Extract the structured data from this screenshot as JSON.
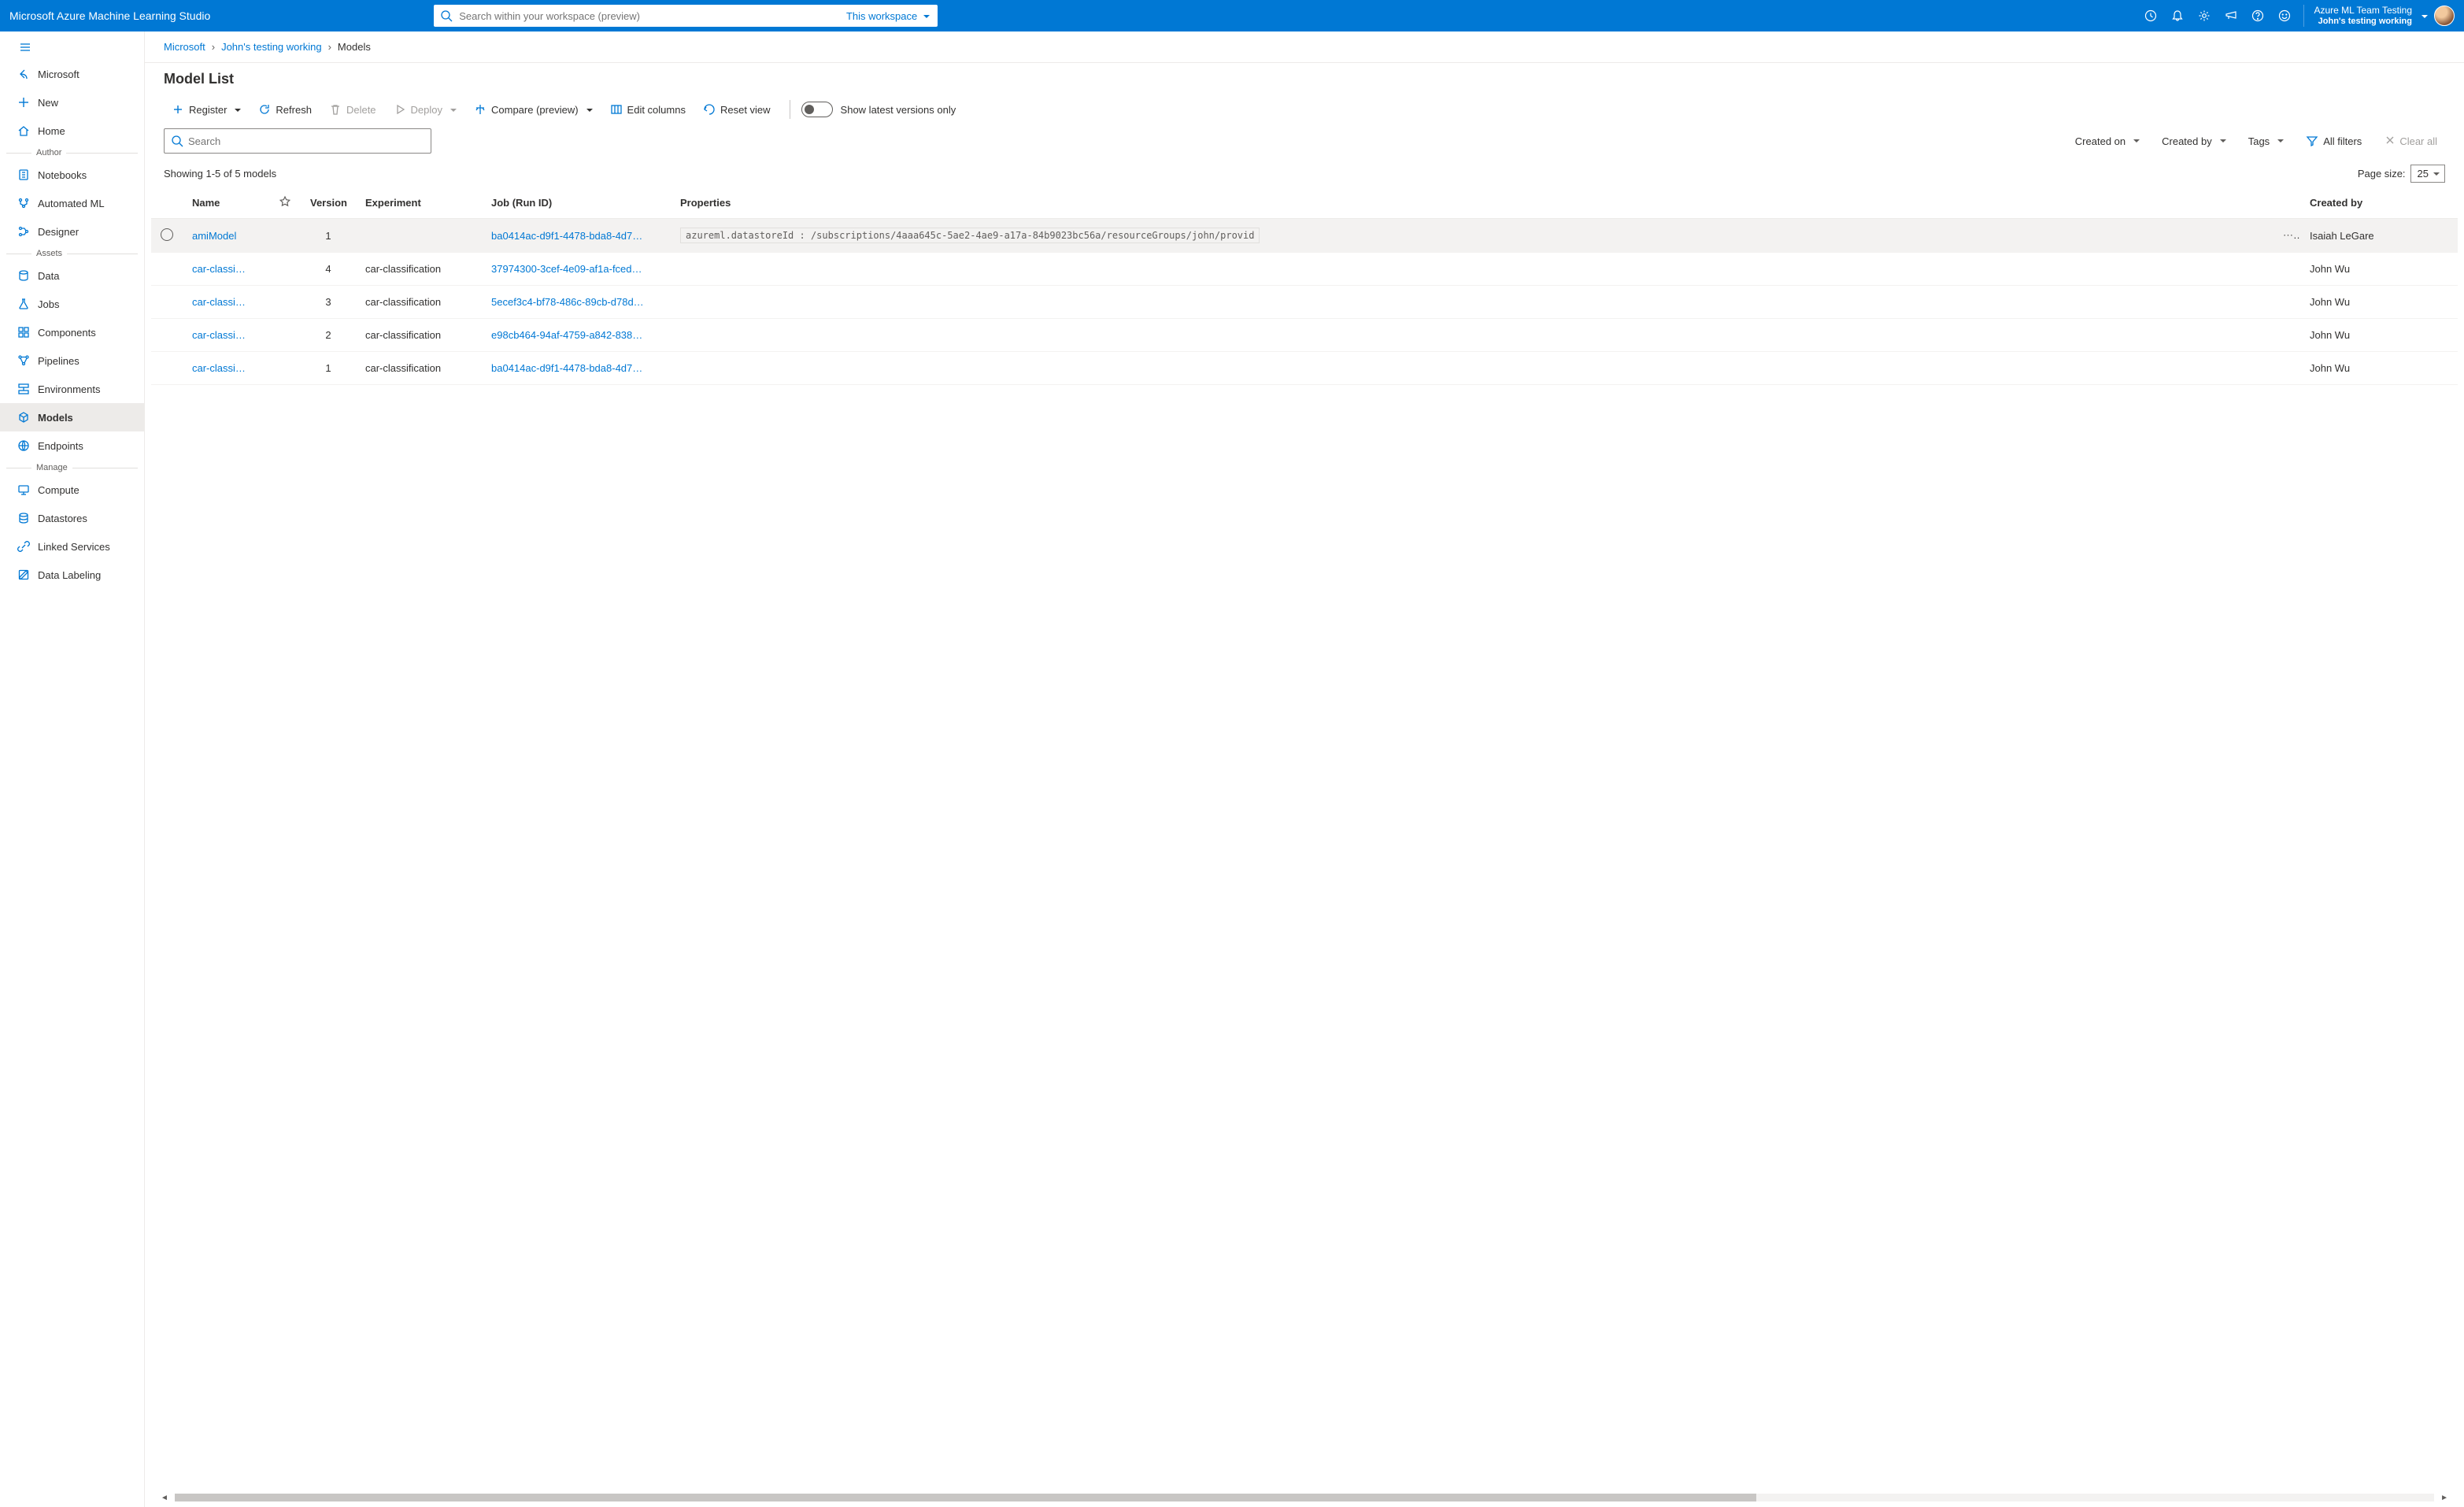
{
  "header": {
    "brand": "Microsoft Azure Machine Learning Studio",
    "search_placeholder": "Search within your workspace (preview)",
    "scope_label": "This workspace",
    "account": {
      "directory": "Azure ML Team Testing",
      "workspace": "John's testing working"
    }
  },
  "sidebar": {
    "back_label": "Microsoft",
    "top": [
      {
        "label": "New"
      },
      {
        "label": "Home"
      }
    ],
    "author_heading": "Author",
    "author": [
      {
        "label": "Notebooks"
      },
      {
        "label": "Automated ML"
      },
      {
        "label": "Designer"
      }
    ],
    "assets_heading": "Assets",
    "assets": [
      {
        "label": "Data"
      },
      {
        "label": "Jobs"
      },
      {
        "label": "Components"
      },
      {
        "label": "Pipelines"
      },
      {
        "label": "Environments"
      },
      {
        "label": "Models",
        "active": true
      },
      {
        "label": "Endpoints"
      }
    ],
    "manage_heading": "Manage",
    "manage": [
      {
        "label": "Compute"
      },
      {
        "label": "Datastores"
      },
      {
        "label": "Linked Services"
      },
      {
        "label": "Data Labeling"
      }
    ]
  },
  "breadcrumbs": [
    {
      "label": "Microsoft",
      "link": true
    },
    {
      "label": "John's testing working",
      "link": true
    },
    {
      "label": "Models",
      "link": false
    }
  ],
  "page": {
    "title": "Model List"
  },
  "commands": {
    "register": "Register",
    "refresh": "Refresh",
    "delete": "Delete",
    "deploy": "Deploy",
    "compare": "Compare (preview)",
    "edit_columns": "Edit columns",
    "reset_view": "Reset view",
    "latest_toggle": "Show latest versions only"
  },
  "filters": {
    "search_placeholder": "Search",
    "created_on": "Created on",
    "created_by": "Created by",
    "tags": "Tags",
    "all_filters": "All filters",
    "clear_all": "Clear all"
  },
  "summary": {
    "showing": "Showing 1-5 of 5 models",
    "page_size_label": "Page size:",
    "page_size_value": "25"
  },
  "table": {
    "columns": {
      "name": "Name",
      "version": "Version",
      "experiment": "Experiment",
      "job": "Job (Run ID)",
      "properties": "Properties",
      "created_by": "Created by"
    },
    "rows": [
      {
        "name": "amiModel",
        "version": "1",
        "experiment": "",
        "job": "ba0414ac-d9f1-4478-bda8-4d7…",
        "properties": "azureml.datastoreId : /subscriptions/4aaa645c-5ae2-4ae9-a17a-84b9023bc56a/resourceGroups/john/provid",
        "created_by": "Isaiah LeGare",
        "hovered": true
      },
      {
        "name": "car-classi…",
        "version": "4",
        "experiment": "car-classification",
        "job": "37974300-3cef-4e09-af1a-fced…",
        "properties": "",
        "created_by": "John Wu"
      },
      {
        "name": "car-classi…",
        "version": "3",
        "experiment": "car-classification",
        "job": "5ecef3c4-bf78-486c-89cb-d78d…",
        "properties": "",
        "created_by": "John Wu"
      },
      {
        "name": "car-classi…",
        "version": "2",
        "experiment": "car-classification",
        "job": "e98cb464-94af-4759-a842-838…",
        "properties": "",
        "created_by": "John Wu"
      },
      {
        "name": "car-classi…",
        "version": "1",
        "experiment": "car-classification",
        "job": "ba0414ac-d9f1-4478-bda8-4d7…",
        "properties": "",
        "created_by": "John Wu"
      }
    ]
  }
}
